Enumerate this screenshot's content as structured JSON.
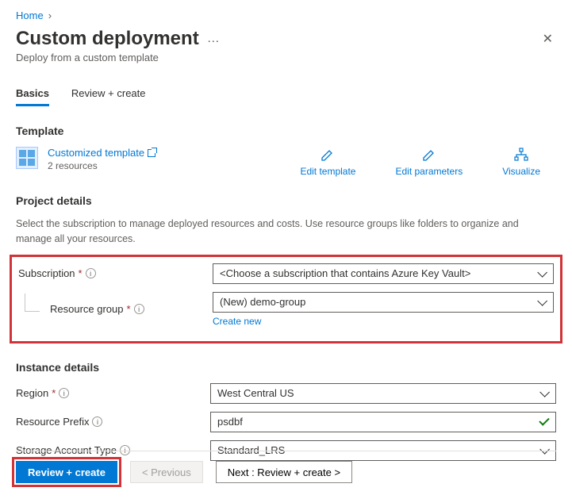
{
  "breadcrumb": {
    "home": "Home"
  },
  "header": {
    "title": "Custom deployment",
    "subtitle": "Deploy from a custom template"
  },
  "tabs": {
    "basics": "Basics",
    "review": "Review + create"
  },
  "template": {
    "section": "Template",
    "name": "Customized template",
    "resources": "2 resources",
    "actions": {
      "edit_template": "Edit template",
      "edit_parameters": "Edit parameters",
      "visualize": "Visualize"
    }
  },
  "project": {
    "section": "Project details",
    "description": "Select the subscription to manage deployed resources and costs. Use resource groups like folders to organize and manage all your resources.",
    "subscription_label": "Subscription",
    "subscription_value": "<Choose a subscription that contains Azure Key Vault>",
    "rg_label": "Resource group",
    "rg_value": "(New) demo-group",
    "create_new": "Create new"
  },
  "instance": {
    "section": "Instance details",
    "region_label": "Region",
    "region_value": "West Central US",
    "prefix_label": "Resource Prefix",
    "prefix_value": "psdbf",
    "storage_label": "Storage Account Type",
    "storage_value": "Standard_LRS"
  },
  "footer": {
    "review": "Review + create",
    "previous": "< Previous",
    "next": "Next : Review + create >"
  }
}
